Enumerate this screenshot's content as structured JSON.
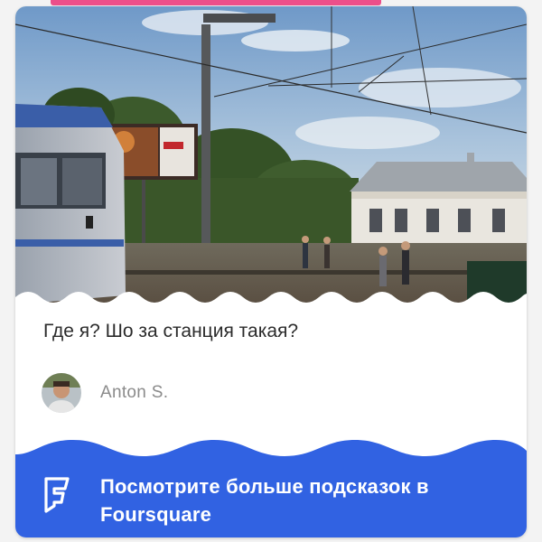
{
  "tip": {
    "text": "Где я? Шо за станция такая?"
  },
  "author": {
    "name": "Anton S."
  },
  "cta": {
    "label": "Посмотрите больше подсказок в Foursquare"
  },
  "icons": {
    "logo": "foursquare-logo-icon",
    "avatar": "user-photo",
    "photo": "train-station-photo"
  },
  "colors": {
    "accent_blue": "#3162e2",
    "top_strip_pink": "#ec4f8a",
    "tip_text": "#2b2b2b",
    "author_text": "#8b8b8b"
  }
}
